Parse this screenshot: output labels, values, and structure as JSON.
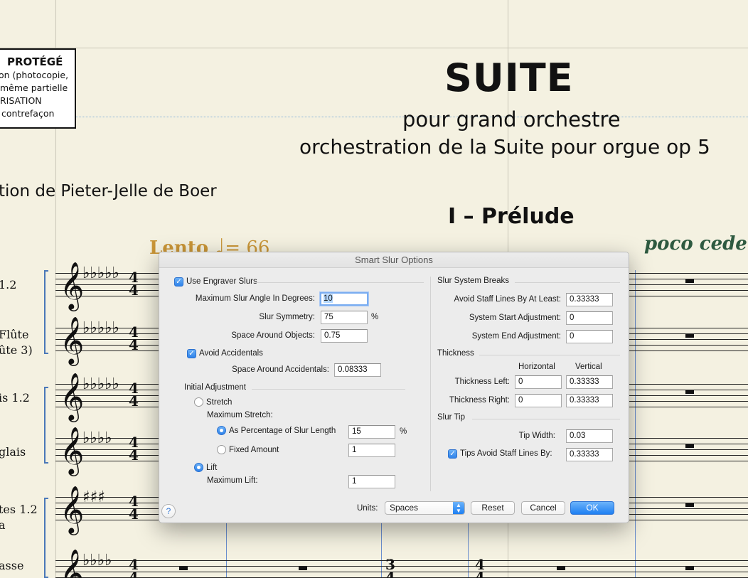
{
  "score": {
    "copyright_lines": [
      "PROTÉGÉ",
      "on (photocopie,",
      "même partielle",
      "RISATION",
      "contrefaçon"
    ],
    "title": "SUITE",
    "subtitle_1": "pour grand orchestre",
    "subtitle_2": "orchestration de la Suite pour orgue op 5",
    "arranger": "tion de Pieter-Jelle de Boer",
    "movement": "I – Prélude",
    "tempo_text": "Lento",
    "tempo_note": "♩",
    "tempo_value": "= 66",
    "expression": "poco cedend",
    "instruments": [
      {
        "line1": "1.2",
        "line2": ""
      },
      {
        "line1": "Flûte",
        "line2": "ûte 3)"
      },
      {
        "line1": "is 1.2",
        "line2": ""
      },
      {
        "line1": "glais",
        "line2": ""
      },
      {
        "line1": "tes 1.2",
        "line2": "a"
      },
      {
        "line1": "asse",
        "line2": ""
      }
    ],
    "clef_glyph": "𝄞",
    "key_flats_5": "♭♭♭♭♭",
    "key_flats_4": "♭♭♭♭",
    "key_sharps_3": "♯♯♯",
    "time_signature": {
      "top": "4",
      "bottom": "4"
    },
    "time_signature_alt": {
      "top": "3",
      "bottom": "4"
    }
  },
  "dialog": {
    "title": "Smart Slur Options",
    "left": {
      "use_engraver_slurs": {
        "label": "Use Engraver Slurs",
        "checked": true
      },
      "max_slur_angle": {
        "label": "Maximum Slur Angle In Degrees:",
        "value": "10"
      },
      "slur_symmetry": {
        "label": "Slur Symmetry:",
        "value": "75",
        "unit": "%"
      },
      "space_around_objects": {
        "label": "Space Around Objects:",
        "value": "0.75"
      },
      "avoid_accidentals": {
        "label": "Avoid Accidentals",
        "checked": true
      },
      "space_around_accidentals": {
        "label": "Space Around Accidentals:",
        "value": "0.08333"
      },
      "initial_adjustment": {
        "title": "Initial Adjustment",
        "stretch": {
          "label": "Stretch",
          "selected": false
        },
        "maximum_stretch_label": "Maximum Stretch:",
        "as_percentage": {
          "label": "As Percentage of Slur Length",
          "selected": true,
          "value": "15",
          "unit": "%"
        },
        "fixed_amount": {
          "label": "Fixed Amount",
          "selected": false,
          "value": "1"
        },
        "lift": {
          "label": "Lift",
          "selected": true
        },
        "maximum_lift": {
          "label": "Maximum Lift:",
          "value": "1"
        }
      }
    },
    "right": {
      "system_breaks": {
        "title": "Slur System Breaks",
        "avoid_staff_lines": {
          "label": "Avoid Staff Lines By At Least:",
          "value": "0.33333"
        },
        "system_start": {
          "label": "System Start Adjustment:",
          "value": "0"
        },
        "system_end": {
          "label": "System End Adjustment:",
          "value": "0"
        }
      },
      "thickness": {
        "title": "Thickness",
        "col_horizontal": "Horizontal",
        "col_vertical": "Vertical",
        "left": {
          "label": "Thickness Left:",
          "horizontal": "0",
          "vertical": "0.33333"
        },
        "right": {
          "label": "Thickness Right:",
          "horizontal": "0",
          "vertical": "0.33333"
        }
      },
      "slur_tip": {
        "title": "Slur Tip",
        "tip_width": {
          "label": "Tip Width:",
          "value": "0.03"
        },
        "tips_avoid": {
          "label": "Tips Avoid Staff Lines By:",
          "checked": true,
          "value": "0.33333"
        }
      }
    },
    "footer": {
      "help": "?",
      "units_label": "Units:",
      "units_value": "Spaces",
      "reset": "Reset",
      "cancel": "Cancel",
      "ok": "OK"
    }
  }
}
